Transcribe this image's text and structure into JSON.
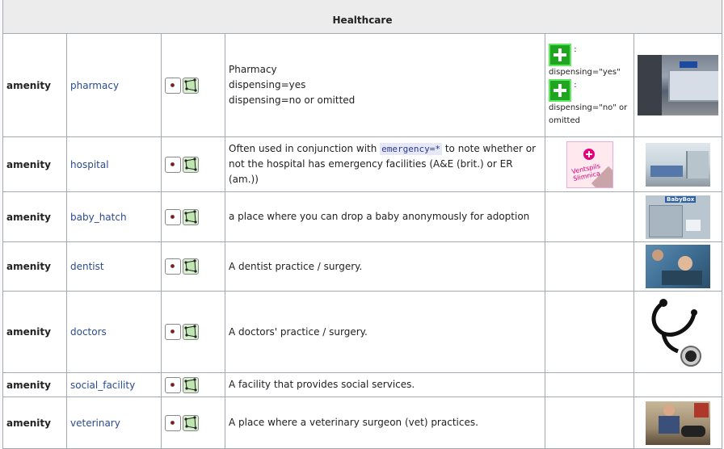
{
  "section_title": "Healthcare",
  "rows": [
    {
      "key": "amenity",
      "value": "pharmacy",
      "desc_lines": [
        "Pharmacy",
        "dispensing=yes",
        "dispensing=no or omitted"
      ],
      "render": {
        "suffix1": ":",
        "caption1": "dispensing=\"yes\"",
        "suffix2": ":",
        "caption2": "dispensing=\"no\" or omitted"
      }
    },
    {
      "key": "amenity",
      "value": "hospital",
      "desc_pre": "Often used in conjunction with ",
      "desc_code": "emergency=*",
      "desc_post": " to note whether or not the hospital has emergency facilities (A&E (brit.) or ER (am.))",
      "render_logo": "Ventspils Slimnica"
    },
    {
      "key": "amenity",
      "value": "baby_hatch",
      "desc": "a place where you can drop a baby anonymously for adoption",
      "photo_label": "BabyBox"
    },
    {
      "key": "amenity",
      "value": "dentist",
      "desc": "A dentist practice / surgery."
    },
    {
      "key": "amenity",
      "value": "doctors",
      "desc": "A doctors' practice / surgery."
    },
    {
      "key": "amenity",
      "value": "social_facility",
      "desc": "A facility that provides social services."
    },
    {
      "key": "amenity",
      "value": "veterinary",
      "desc": "A place where a veterinary surgeon (vet) practices."
    }
  ],
  "icons": {
    "node": "node-icon",
    "area": "area-icon",
    "cross": "green-cross-icon"
  }
}
